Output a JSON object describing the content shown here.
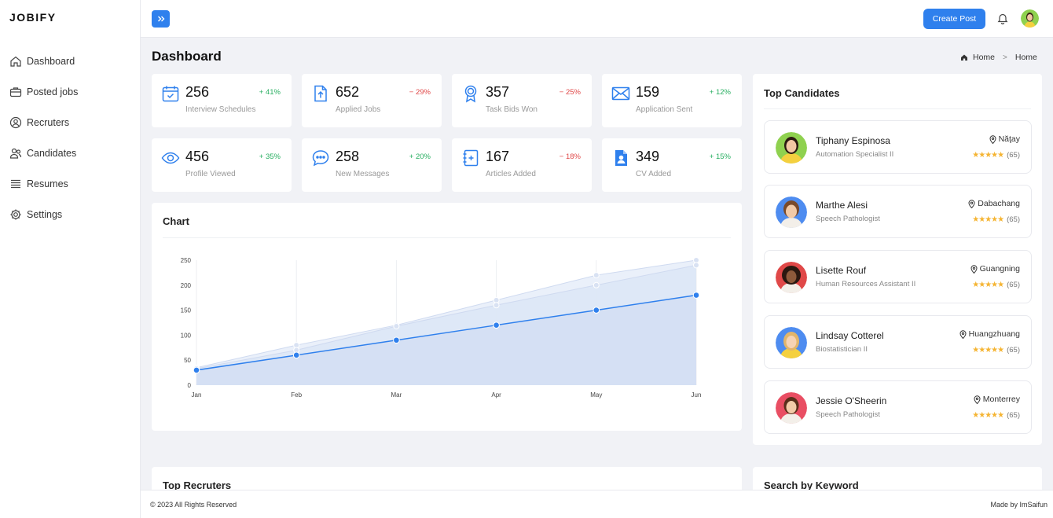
{
  "app": {
    "logo": "JOBIFY"
  },
  "sidebar": {
    "items": [
      {
        "label": "Dashboard",
        "icon": "home-icon"
      },
      {
        "label": "Posted jobs",
        "icon": "briefcase-icon"
      },
      {
        "label": "Recruters",
        "icon": "user-circle-icon"
      },
      {
        "label": "Candidates",
        "icon": "users-icon"
      },
      {
        "label": "Resumes",
        "icon": "list-icon"
      },
      {
        "label": "Settings",
        "icon": "gear-icon"
      }
    ]
  },
  "topbar": {
    "create_label": "Create Post"
  },
  "page": {
    "title": "Dashboard"
  },
  "breadcrumb": {
    "home": "Home",
    "current": "Home"
  },
  "stats": [
    {
      "value": "256",
      "change": "+ 41%",
      "dir": "up",
      "label": "Interview Schedules",
      "icon": "calendar-check-icon"
    },
    {
      "value": "652",
      "change": "− 29%",
      "dir": "down",
      "label": "Applied Jobs",
      "icon": "file-upload-icon"
    },
    {
      "value": "357",
      "change": "− 25%",
      "dir": "down",
      "label": "Task Bids Won",
      "icon": "award-icon"
    },
    {
      "value": "159",
      "change": "+ 12%",
      "dir": "up",
      "label": "Application Sent",
      "icon": "mail-icon"
    },
    {
      "value": "456",
      "change": "+ 35%",
      "dir": "up",
      "label": "Profile Viewed",
      "icon": "eye-icon"
    },
    {
      "value": "258",
      "change": "+ 20%",
      "dir": "up",
      "label": "New Messages",
      "icon": "chat-icon"
    },
    {
      "value": "167",
      "change": "− 18%",
      "dir": "down",
      "label": "Articles Added",
      "icon": "notebook-plus-icon"
    },
    {
      "value": "349",
      "change": "+ 15%",
      "dir": "up",
      "label": "CV Added",
      "icon": "contact-file-icon"
    }
  ],
  "chart_card": {
    "title": "Chart"
  },
  "chart_data": {
    "type": "area",
    "categories": [
      "Jan",
      "Feb",
      "Mar",
      "Apr",
      "May",
      "Jun"
    ],
    "ylim": [
      0,
      250
    ],
    "yticks": [
      0,
      50,
      100,
      150,
      200,
      250
    ],
    "series": [
      {
        "values": [
          35,
          80,
          120,
          170,
          220,
          250
        ],
        "color": "#c9d6ef"
      },
      {
        "values": [
          33,
          70,
          118,
          160,
          200,
          240
        ],
        "color": "#c9d6ef"
      },
      {
        "values": [
          30,
          60,
          90,
          120,
          150,
          180
        ],
        "color": "#2f80ed"
      }
    ]
  },
  "candidates_card": {
    "title": "Top Candidates"
  },
  "candidates": [
    {
      "name": "Tiphany Espinosa",
      "role": "Automation Specialist II",
      "location": "Năţay",
      "rating": "(65)"
    },
    {
      "name": "Marthe Alesi",
      "role": "Speech Pathologist",
      "location": "Dabachang",
      "rating": "(65)"
    },
    {
      "name": "Lisette Rouf",
      "role": "Human Resources Assistant II",
      "location": "Guangning",
      "rating": "(65)"
    },
    {
      "name": "Lindsay Cotterel",
      "role": "Biostatistician II",
      "location": "Huangzhuang",
      "rating": "(65)"
    },
    {
      "name": "Jessie O'Sheerin",
      "role": "Speech Pathologist",
      "location": "Monterrey",
      "rating": "(65)"
    }
  ],
  "bottom": {
    "recruiters_title": "Top Recruters",
    "keyword_title": "Search by Keyword"
  },
  "footer": {
    "copyright": "© 2023 All Rights Reserved",
    "credit": "Made by ImSaifun"
  },
  "colors": {
    "accent": "#2f80ed",
    "up": "#27ae60",
    "down": "#e04848",
    "star": "#f5b432"
  }
}
